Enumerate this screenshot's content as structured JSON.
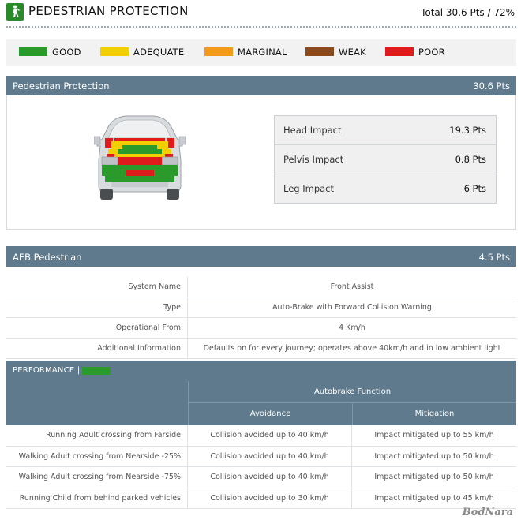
{
  "header": {
    "title": "PEDESTRIAN PROTECTION",
    "total": "Total 30.6 Pts / 72%",
    "icon": "pedestrian-icon"
  },
  "legend": [
    {
      "label": "GOOD",
      "color": "#2a9a2a"
    },
    {
      "label": "ADEQUATE",
      "color": "#f2cf00"
    },
    {
      "label": "MARGINAL",
      "color": "#f39a1a"
    },
    {
      "label": "WEAK",
      "color": "#8a4a1c"
    },
    {
      "label": "POOR",
      "color": "#e01b1b"
    }
  ],
  "pedestrian_protection": {
    "title": "Pedestrian Protection",
    "points": "30.6 Pts",
    "impacts": [
      {
        "name": "Head Impact",
        "value": "19.3 Pts"
      },
      {
        "name": "Pelvis Impact",
        "value": "0.8 Pts"
      },
      {
        "name": "Leg Impact",
        "value": "6 Pts"
      }
    ]
  },
  "aeb": {
    "title": "AEB Pedestrian",
    "points": "4.5 Pts",
    "rows": [
      {
        "key": "System Name",
        "value": "Front Assist"
      },
      {
        "key": "Type",
        "value": "Auto-Brake with Forward Collision Warning"
      },
      {
        "key": "Operational From",
        "value": "4 Km/h"
      },
      {
        "key": "Additional Information",
        "value": "Defaults on for every journey; operates above 40km/h and in low ambient light"
      }
    ]
  },
  "performance": {
    "label": "PERFORMANCE |",
    "rating_color": "#2a9a2a",
    "group_header": "Autobrake Function",
    "col_avoidance": "Avoidance",
    "col_mitigation": "Mitigation",
    "rows": [
      {
        "scenario": "Running Adult crossing from Farside",
        "avoidance": "Collision avoided up to 40 km/h",
        "mitigation": "Impact mitigated up to 55 km/h"
      },
      {
        "scenario": "Walking Adult crossing from Nearside -25%",
        "avoidance": "Collision avoided up to 40 km/h",
        "mitigation": "Impact mitigated up to 50 km/h"
      },
      {
        "scenario": "Walking Adult crossing from Nearside -75%",
        "avoidance": "Collision avoided up to 40 km/h",
        "mitigation": "Impact mitigated up to 50 km/h"
      },
      {
        "scenario": "Running Child from behind parked vehicles",
        "avoidance": "Collision avoided up to 30 km/h",
        "mitigation": "Impact mitigated up to 45 km/h"
      }
    ]
  },
  "watermark": "BodNara"
}
